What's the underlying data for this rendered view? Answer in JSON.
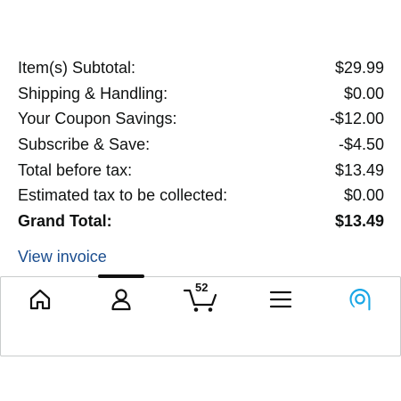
{
  "order_summary": {
    "rows": [
      {
        "label": "Item(s) Subtotal:",
        "value": "$29.99"
      },
      {
        "label": "Shipping & Handling:",
        "value": "$0.00"
      },
      {
        "label": "Your Coupon Savings:",
        "value": "-$12.00"
      },
      {
        "label": "Subscribe & Save:",
        "value": "-$4.50"
      },
      {
        "label": "Total before tax:",
        "value": "$13.49"
      },
      {
        "label": "Estimated tax to be collected:",
        "value": "$0.00"
      }
    ],
    "grand_total": {
      "label": "Grand Total:",
      "value": "$13.49"
    },
    "invoice_link": "View invoice"
  },
  "bottom_nav": {
    "active_tab": "account",
    "cart_count": "52",
    "items": [
      {
        "id": "home",
        "icon": "home-icon"
      },
      {
        "id": "account",
        "icon": "person-icon"
      },
      {
        "id": "cart",
        "icon": "cart-icon"
      },
      {
        "id": "menu",
        "icon": "hamburger-menu-icon"
      },
      {
        "id": "alexa",
        "icon": "alexa-icon"
      }
    ]
  },
  "colors": {
    "link": "#1a4d8f",
    "text": "#0f1111",
    "alexa_blue": "#1aa7e6",
    "indicator": "#111111"
  }
}
